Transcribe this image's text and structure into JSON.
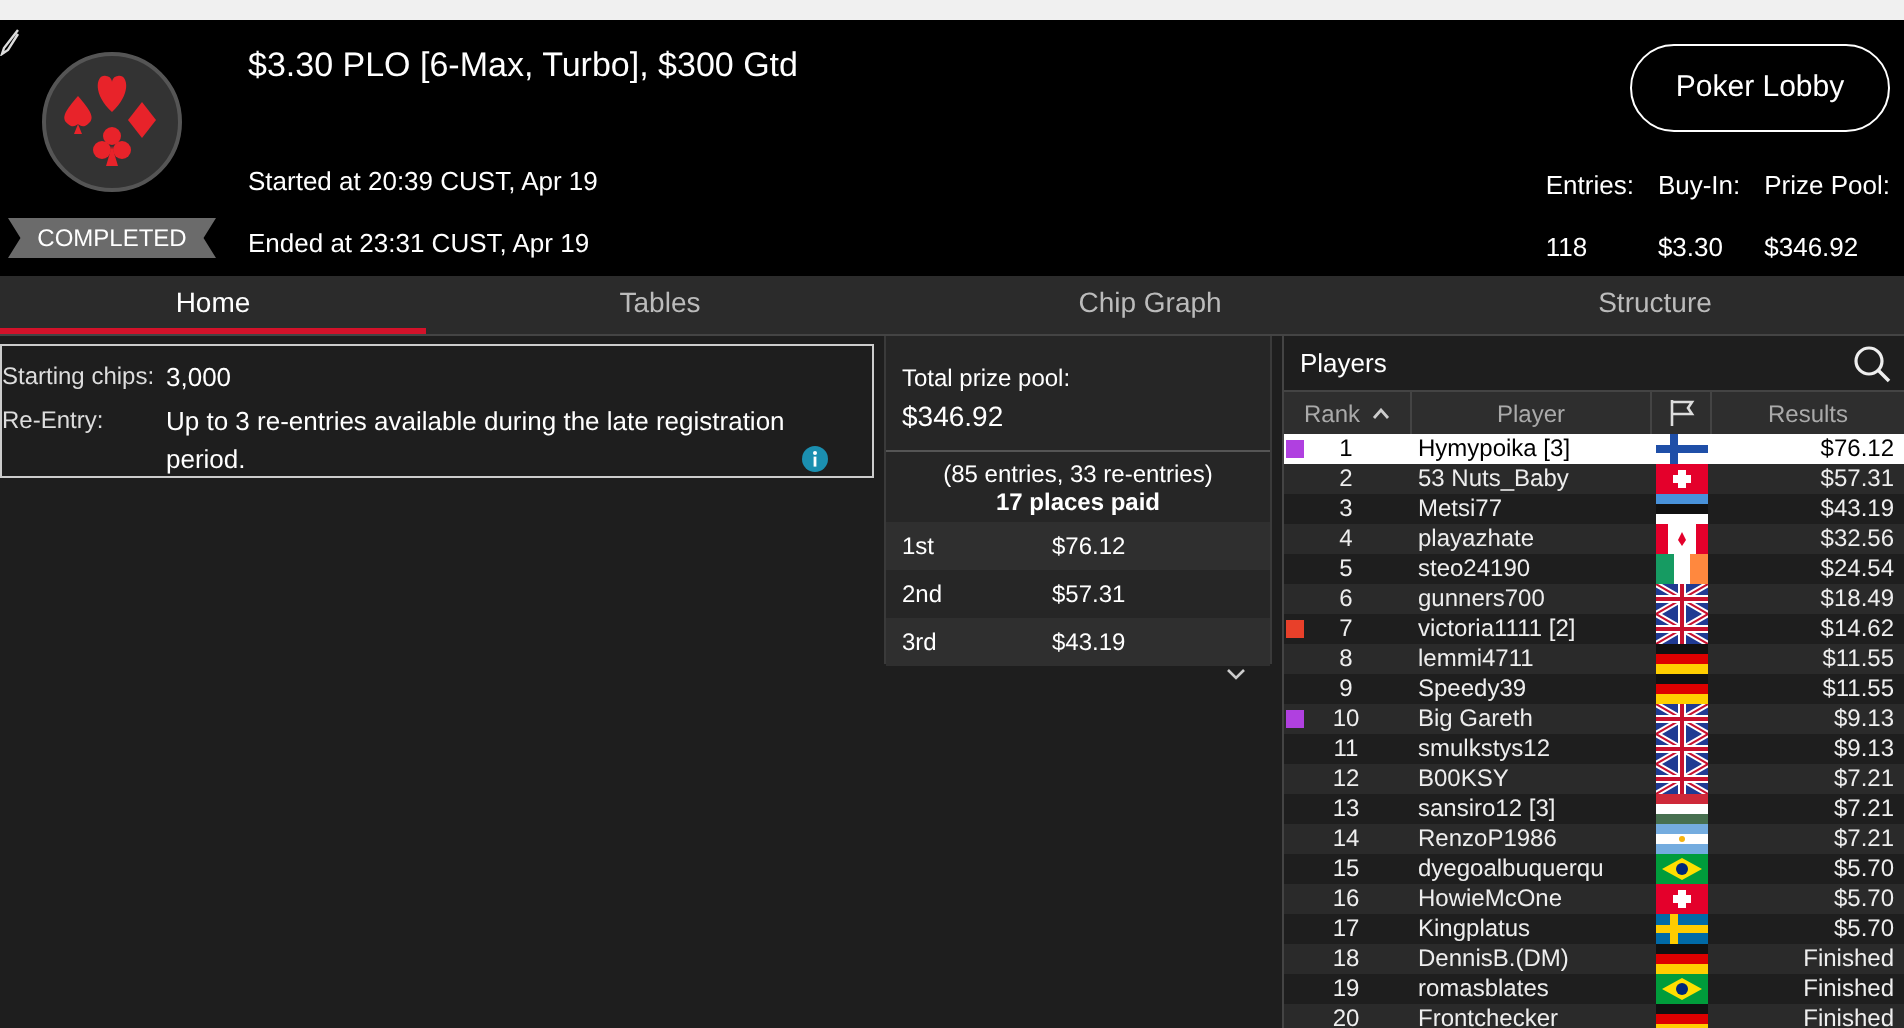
{
  "header": {
    "title": "$3.30 PLO [6-Max, Turbo], $300 Gtd",
    "status": "COMPLETED",
    "started": "Started at 20:39 CUST, Apr 19",
    "ended": "Ended at 23:31 CUST, Apr 19",
    "lobby_button": "Poker Lobby",
    "stats": [
      {
        "label": "Entries:",
        "value": "118"
      },
      {
        "label": "Buy-In:",
        "value": "$3.30"
      },
      {
        "label": "Prize Pool:",
        "value": "$346.92"
      }
    ]
  },
  "tabs": [
    {
      "label": "Home",
      "selected": true
    },
    {
      "label": "Tables",
      "selected": false
    },
    {
      "label": "Chip Graph",
      "selected": false
    },
    {
      "label": "Structure",
      "selected": false
    }
  ],
  "info": [
    {
      "label": "Starting chips:",
      "value": "3,000"
    },
    {
      "label": "Re-Entry:",
      "value": "Up to 3 re-entries available during the late registration period.",
      "info_icon": true
    }
  ],
  "prizes": {
    "title": "Total prize pool:",
    "total": "$346.92",
    "entries": "(85 entries, 33 re-entries)",
    "paid": "17 places paid",
    "places": [
      {
        "place": "1st",
        "amount": "$76.12"
      },
      {
        "place": "2nd",
        "amount": "$57.31"
      },
      {
        "place": "3rd",
        "amount": "$43.19"
      }
    ]
  },
  "players": {
    "title": "Players",
    "columns": [
      "Rank",
      "Player",
      "Results"
    ],
    "rows": [
      {
        "rank": "1",
        "player": "Hymypoika [3]",
        "kind": "fi",
        "result": "$76.12",
        "selected": true,
        "color": "#b040e0"
      },
      {
        "rank": "2",
        "player": "53 Nuts_Baby",
        "kind": "ch",
        "result": "$57.31",
        "selected": false
      },
      {
        "rank": "3",
        "player": "Metsi77",
        "kind": "ee",
        "result": "$43.19",
        "selected": false
      },
      {
        "rank": "4",
        "player": "playazhate",
        "kind": "ca",
        "result": "$32.56",
        "selected": false
      },
      {
        "rank": "5",
        "player": "steo24190",
        "kind": "ie",
        "result": "$24.54",
        "selected": false
      },
      {
        "rank": "6",
        "player": "gunners700",
        "kind": "gb",
        "result": "$18.49",
        "selected": false
      },
      {
        "rank": "7",
        "player": "victoria1111 [2]",
        "kind": "gb",
        "result": "$14.62",
        "selected": false,
        "color": "#e8402a"
      },
      {
        "rank": "8",
        "player": "lemmi4711",
        "kind": "de",
        "result": "$11.55",
        "selected": false
      },
      {
        "rank": "9",
        "player": "Speedy39",
        "kind": "de",
        "result": "$11.55",
        "selected": false
      },
      {
        "rank": "10",
        "player": "Big Gareth",
        "kind": "gb",
        "result": "$9.13",
        "selected": false,
        "color": "#b040e0"
      },
      {
        "rank": "11",
        "player": "smulkstys12",
        "kind": "gb",
        "result": "$9.13",
        "selected": false
      },
      {
        "rank": "12",
        "player": "B00KSY",
        "kind": "gb",
        "result": "$7.21",
        "selected": false
      },
      {
        "rank": "13",
        "player": "sansiro12 [3]",
        "kind": "hu",
        "result": "$7.21",
        "selected": false
      },
      {
        "rank": "14",
        "player": "RenzoP1986",
        "kind": "ar",
        "result": "$7.21",
        "selected": false
      },
      {
        "rank": "15",
        "player": "dyegoalbuquerqu",
        "kind": "br",
        "result": "$5.70",
        "selected": false
      },
      {
        "rank": "16",
        "player": "HowieMcOne",
        "kind": "ch",
        "result": "$5.70",
        "selected": false
      },
      {
        "rank": "17",
        "player": "Kingplatus",
        "kind": "se",
        "result": "$5.70",
        "selected": false
      },
      {
        "rank": "18",
        "player": "DennisB.(DM)",
        "kind": "de",
        "result": "Finished",
        "selected": false
      },
      {
        "rank": "19",
        "player": "romasblates",
        "kind": "br",
        "result": "Finished",
        "selected": false
      },
      {
        "rank": "20",
        "player": "Frontchecker",
        "kind": "de",
        "result": "Finished",
        "selected": false
      }
    ]
  }
}
